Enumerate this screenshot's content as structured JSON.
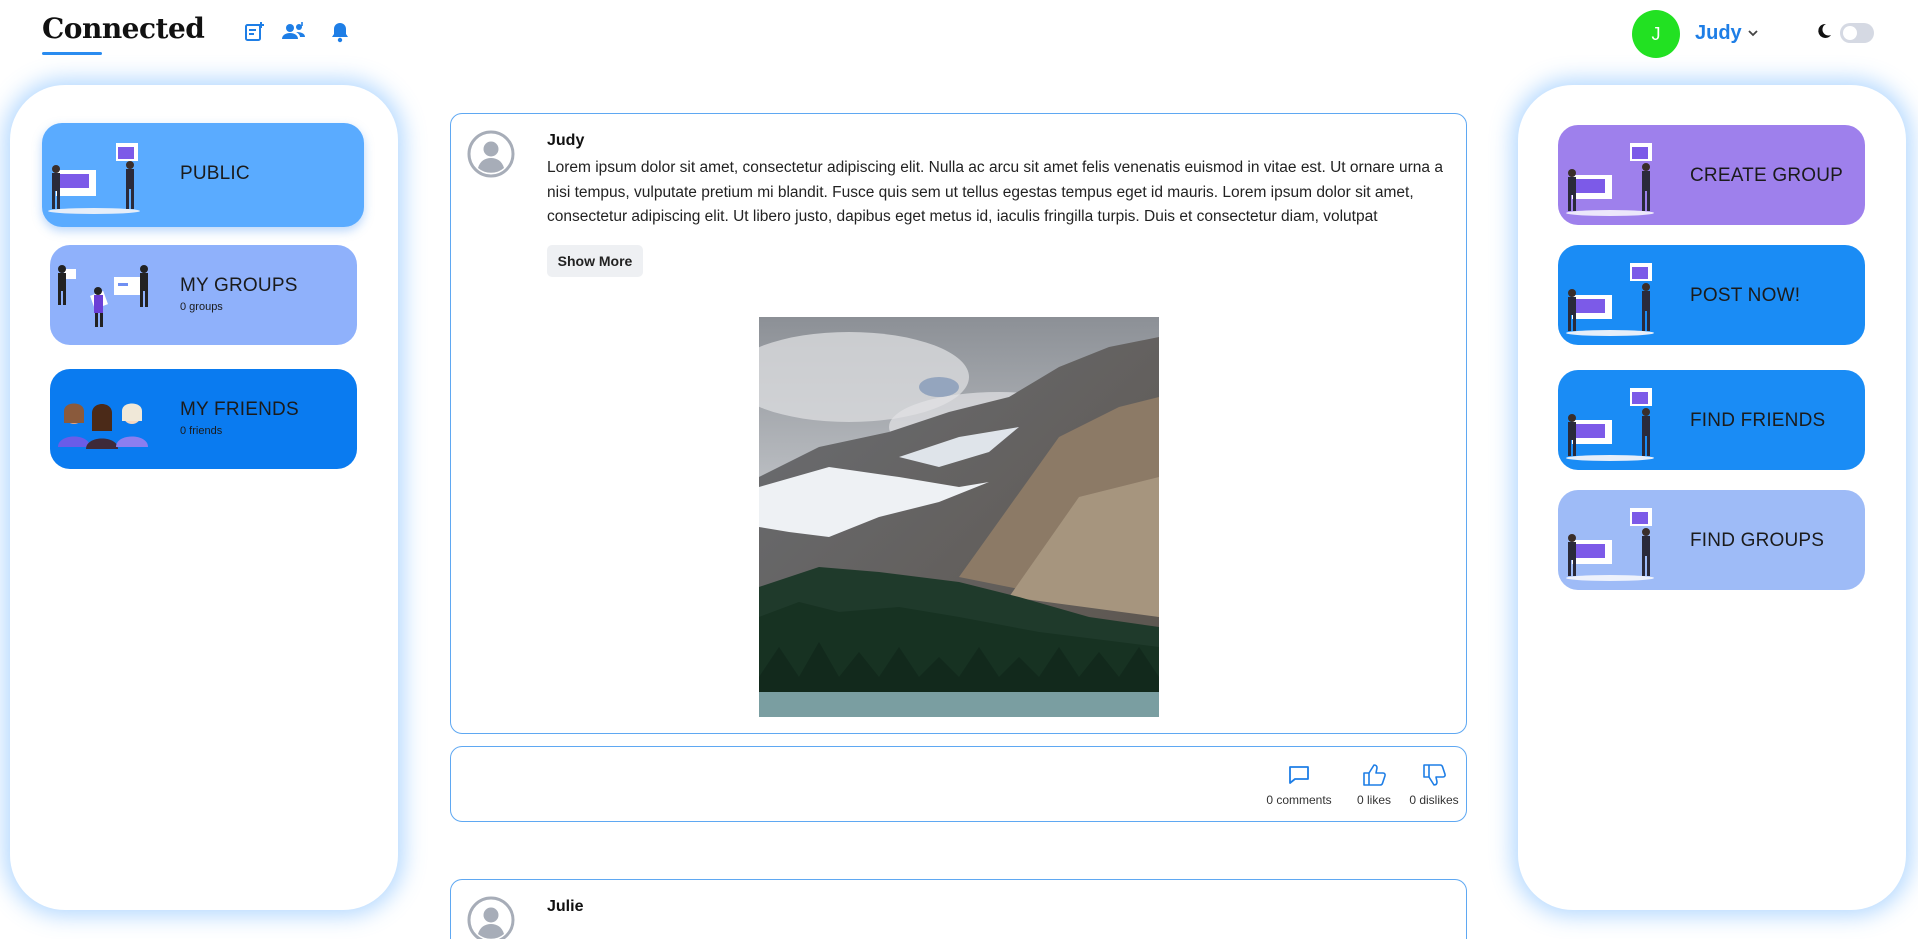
{
  "header": {
    "logo": "Connected",
    "user_initial": "J",
    "user_name": "Judy"
  },
  "left_panel": {
    "cards": [
      {
        "title": "PUBLIC",
        "sub": "",
        "color": "#5aabff"
      },
      {
        "title": "MY GROUPS",
        "sub": "0 groups",
        "color": "#8fb1fb"
      },
      {
        "title": "MY FRIENDS",
        "sub": "0 friends",
        "color": "#0a7bf0"
      }
    ]
  },
  "right_panel": {
    "cards": [
      {
        "title": "CREATE GROUP",
        "color": "#9e80ec"
      },
      {
        "title": "POST NOW!",
        "color": "#1a8cf5"
      },
      {
        "title": "FIND FRIENDS",
        "color": "#1a8cf5"
      },
      {
        "title": "FIND GROUPS",
        "color": "#9ebbf7"
      }
    ]
  },
  "feed": {
    "posts": [
      {
        "author": "Judy",
        "body": "Lorem ipsum dolor sit amet, consectetur adipiscing elit. Nulla ac arcu sit amet felis venenatis euismod in vitae est. Ut ornare urna a nisi tempus, vulputate pretium mi blandit. Fusce quis sem ut tellus egestas tempus eget id mauris. Lorem ipsum dolor sit amet, consectetur adipiscing elit. Ut libero justo, dapibus eget metus id, iaculis fringilla turpis. Duis et consectetur diam, volutpat",
        "show_more": "Show More",
        "comments": "0 comments",
        "likes": "0 likes",
        "dislikes": "0 dislikes"
      },
      {
        "author": "Julie"
      }
    ]
  },
  "colors": {
    "accent": "#1e7ee6",
    "border": "#5fa8f2",
    "avatar": "#22e122"
  }
}
